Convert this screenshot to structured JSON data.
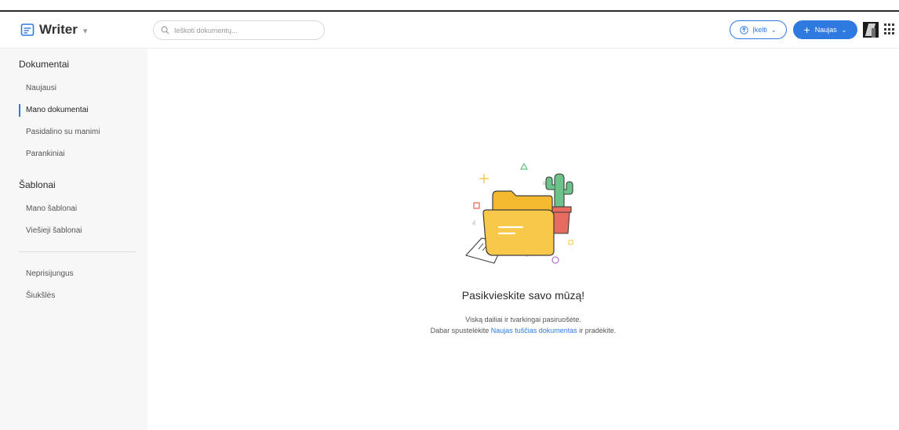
{
  "app": {
    "name": "Writer"
  },
  "search": {
    "placeholder": "Ieškoti dokumentų..."
  },
  "header": {
    "upload_label": "Įkelti",
    "new_label": "Naujas"
  },
  "sidebar": {
    "documents_title": "Dokumentai",
    "documents_items": [
      {
        "label": "Naujausi"
      },
      {
        "label": "Mano dokumentai"
      },
      {
        "label": "Pasidalino su manimi"
      },
      {
        "label": "Parankiniai"
      }
    ],
    "templates_title": "Šablonai",
    "templates_items": [
      {
        "label": "Mano šablonai"
      },
      {
        "label": "Viešieji šablonai"
      }
    ],
    "other_items": [
      {
        "label": "Neprisijungus"
      },
      {
        "label": "Šiukšlės"
      }
    ],
    "active_item": "Mano dokumentai"
  },
  "empty_state": {
    "title": "Pasikvieskite savo mūzą!",
    "line1": "Viską dailiai ir tvarkingai pasiruošėte.",
    "line2_before": "Dabar spustelėkite ",
    "line2_link": "Naujas tuščias dokumentas",
    "line2_after": " ir pradėkite."
  },
  "icons": {
    "brand": "writer-doc-icon",
    "search": "search-icon",
    "upload": "upload-cloud-icon",
    "new": "plus-icon",
    "apps": "apps-grid-icon",
    "illustration": "folder-cactus-illustration"
  },
  "colors": {
    "accent": "#2f7ae0",
    "sidebar_bg": "#f7f7f7",
    "folder": "#f7c84a",
    "cactus": "#6cc38a",
    "pot": "#e86b5f"
  }
}
